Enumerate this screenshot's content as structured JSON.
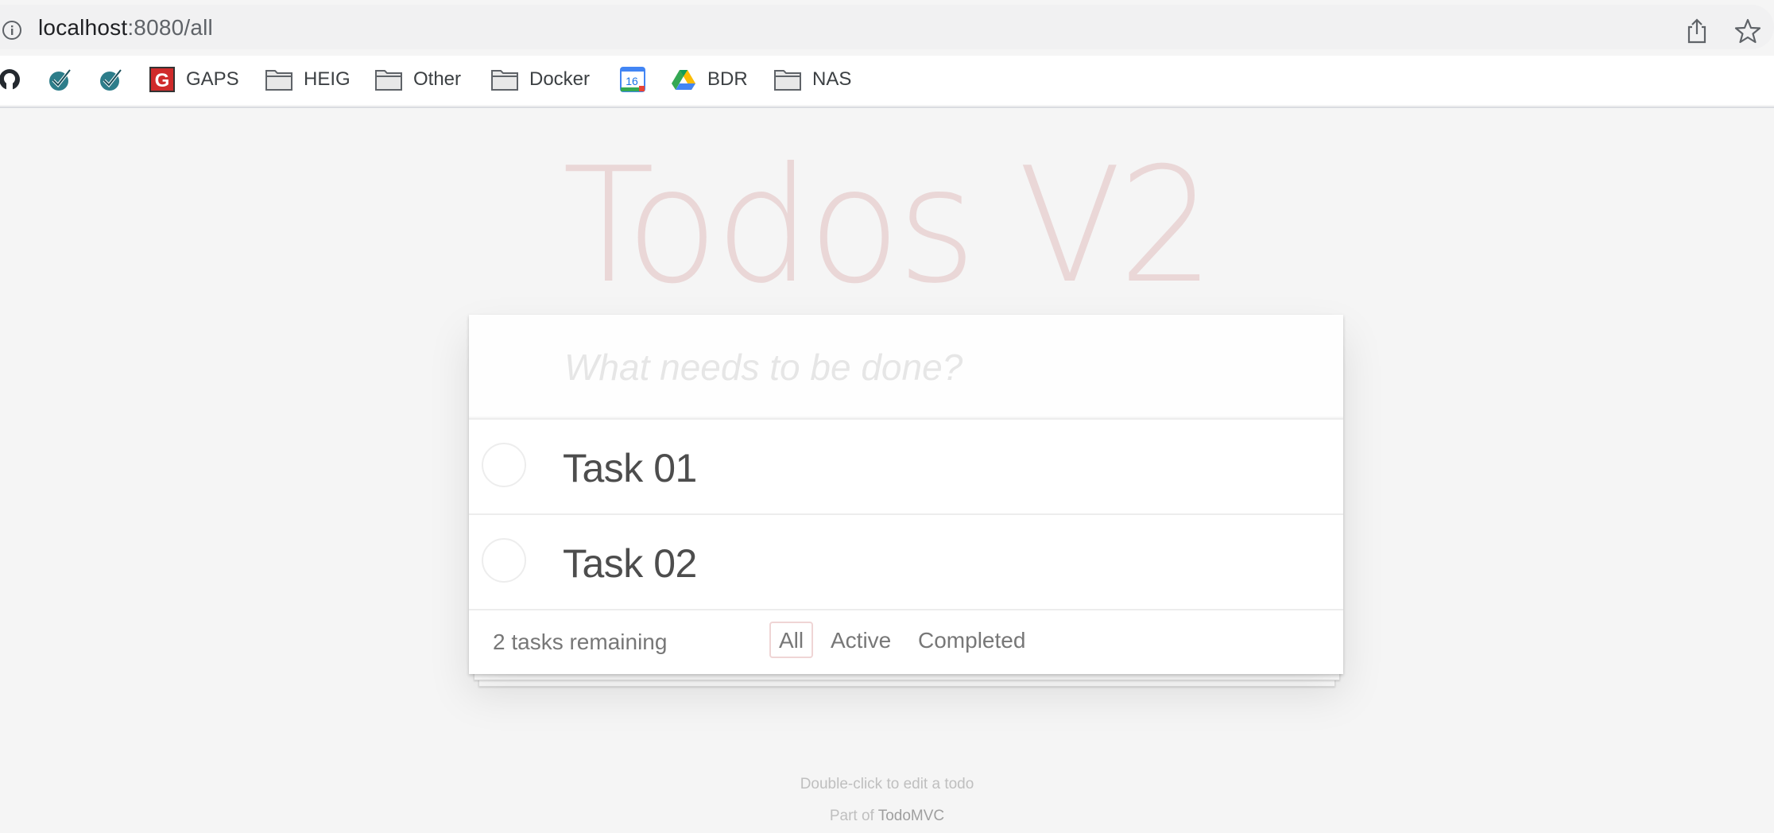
{
  "browser": {
    "url_host": "localhost",
    "url_rest": ":8080/all",
    "bookmarks": [
      {
        "label": "",
        "icon": "github-icon"
      },
      {
        "label": "",
        "icon": "checkmark-badge-icon"
      },
      {
        "label": "",
        "icon": "checkmark-badge-icon"
      },
      {
        "label": "GAPS",
        "icon": "gaps-g-icon"
      },
      {
        "label": "HEIG",
        "icon": "folder-icon"
      },
      {
        "label": "Other",
        "icon": "folder-icon"
      },
      {
        "label": "Docker",
        "icon": "folder-icon"
      },
      {
        "label": "",
        "icon": "calendar-16-icon"
      },
      {
        "label": "BDR",
        "icon": "google-drive-icon"
      },
      {
        "label": "NAS",
        "icon": "folder-icon"
      }
    ]
  },
  "app": {
    "title": "Todos V2",
    "new_todo_placeholder": "What needs to be done?",
    "todos": [
      {
        "label": "Task 01",
        "completed": false
      },
      {
        "label": "Task 02",
        "completed": false
      }
    ],
    "footer": {
      "count_text": "2 tasks remaining",
      "filters": [
        "All",
        "Active",
        "Completed"
      ],
      "selected_filter": "All"
    }
  },
  "info": {
    "hint": "Double-click to edit a todo",
    "part_of": "Part of ",
    "link": "TodoMVC"
  },
  "colors": {
    "accent": "#af2f2f",
    "text": "#4d4d4d",
    "background": "#f5f5f5"
  }
}
